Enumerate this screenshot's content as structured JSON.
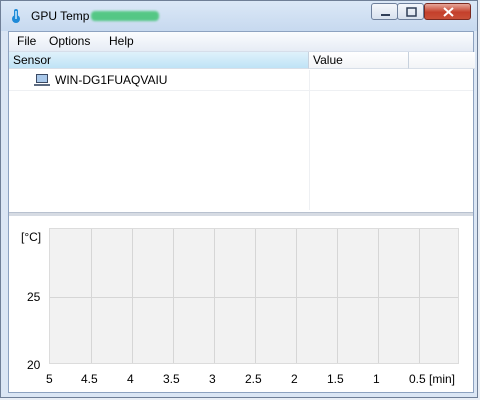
{
  "window": {
    "title": "GPU Temp"
  },
  "menu": [
    "File",
    "Options",
    "Help"
  ],
  "tree": {
    "columns": [
      "Sensor",
      "Value"
    ],
    "rows": [
      {
        "label": "WIN-DG1FUAQVAIU",
        "icon": "computer-icon"
      }
    ]
  },
  "plot": {
    "y_unit": "[°C]",
    "y_ticks": [
      "25",
      "20"
    ],
    "x_ticks": [
      "5",
      "4.5",
      "4",
      "3.5",
      "3",
      "2.5",
      "2",
      "1.5",
      "1",
      "0.5 [min]"
    ]
  },
  "colors": {
    "header_selected": "#bfe3f6",
    "plot_bg": "#f2f2f2",
    "close_button": "#c4402b"
  }
}
